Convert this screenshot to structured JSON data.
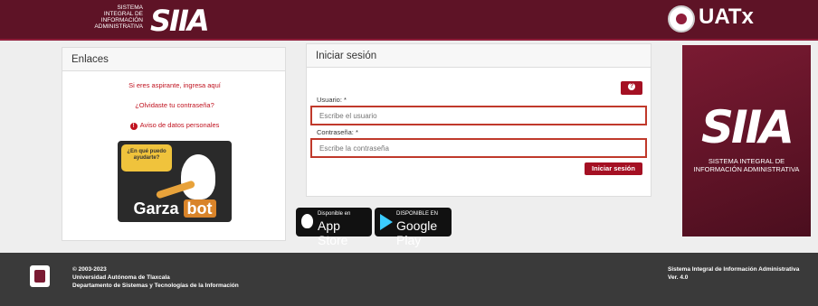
{
  "header": {
    "system_line1": "SISTEMA",
    "system_line2": "INTEGRAL DE",
    "system_line3": "INFORMACIÓN",
    "system_line4": "ADMINISTRATIVA",
    "logo_text": "SIIA",
    "uatx_label": "UATx"
  },
  "links_panel": {
    "title": "Enlaces",
    "aspirante": "Si eres aspirante, ingresa aquí",
    "forgot": "¿Olvidaste tu contraseña?",
    "privacy": "Aviso de datos personales",
    "bot_bubble": "¿En qué puedo ayudarte?",
    "bot_name_part1": "Garza",
    "bot_name_part2": "bot"
  },
  "login_panel": {
    "title": "Iniciar sesión",
    "user_label": "Usuario: *",
    "user_placeholder": "Escribe el usuario",
    "password_label": "Contraseña: *",
    "password_placeholder": "Escribe la contraseña",
    "submit": "Iniciar sesión"
  },
  "stores": {
    "apple_small": "Disponible en",
    "apple_big": "App Store",
    "google_small": "DISPONIBLE EN",
    "google_big": "Google Play"
  },
  "banner": {
    "logo_text": "SIIA",
    "line1": "SISTEMA INTEGRAL DE",
    "line2": "INFORMACIÓN ADMINISTRATIVA"
  },
  "footer": {
    "copyright": "© 2003-2023",
    "university": "Universidad Autónoma de Tlaxcala",
    "department": "Departamento de Sistemas y Tecnologías de la Información",
    "system_name": "Sistema Integral de Información Administrativa",
    "version": "Ver. 4.0"
  },
  "colors": {
    "brand": "#5e1326",
    "accent": "#a41023",
    "footer": "#3a3a3a"
  }
}
